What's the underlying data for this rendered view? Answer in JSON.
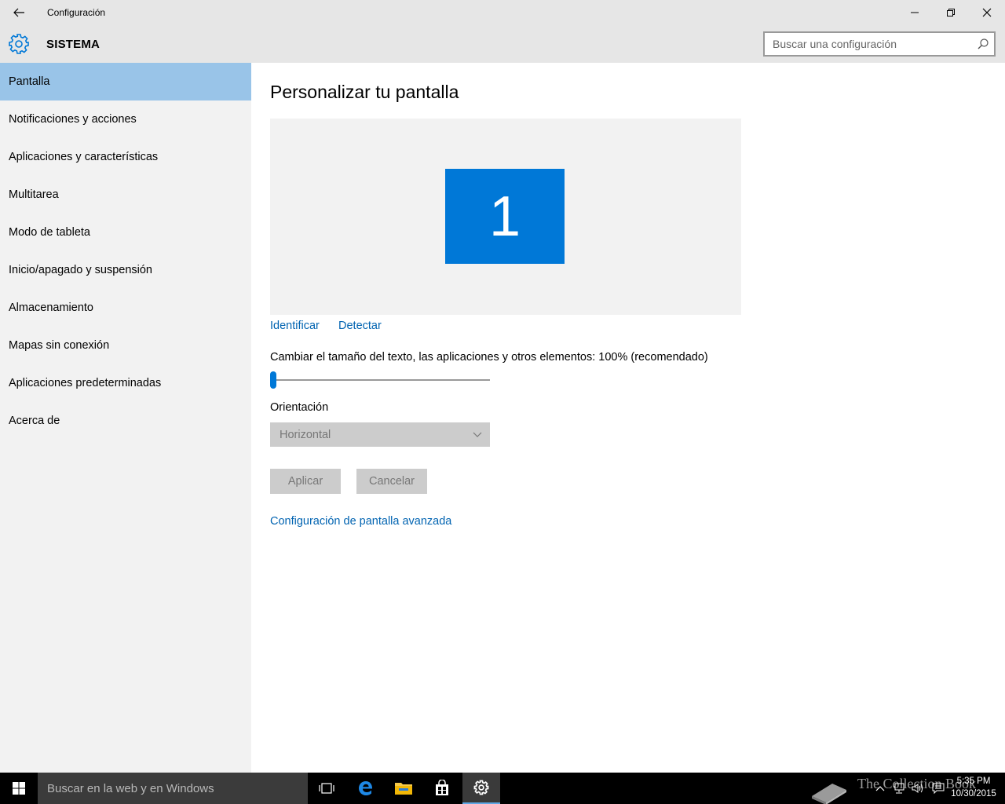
{
  "window": {
    "title": "Configuración",
    "back_icon": "back-arrow-icon",
    "minimize_icon": "minimize-icon",
    "restore_icon": "restore-icon",
    "close_icon": "close-icon"
  },
  "header": {
    "section_icon": "gear-icon",
    "section_title": "SISTEMA",
    "search_placeholder": "Buscar una configuración",
    "search_icon": "search-icon"
  },
  "sidebar": {
    "items": [
      {
        "label": "Pantalla",
        "active": true
      },
      {
        "label": "Notificaciones y acciones"
      },
      {
        "label": "Aplicaciones y características"
      },
      {
        "label": "Multitarea"
      },
      {
        "label": "Modo de tableta"
      },
      {
        "label": "Inicio/apagado y suspensión"
      },
      {
        "label": "Almacenamiento"
      },
      {
        "label": "Mapas sin conexión"
      },
      {
        "label": "Aplicaciones predeterminadas"
      },
      {
        "label": "Acerca de"
      }
    ]
  },
  "main": {
    "title": "Personalizar tu pantalla",
    "monitor_number": "1",
    "identify_link": "Identificar",
    "detect_link": "Detectar",
    "scale_label": "Cambiar el tamaño del texto, las aplicaciones y otros elementos: 100% (recomendado)",
    "scale_slider_value": 0,
    "orientation_label": "Orientación",
    "orientation_value": "Horizontal",
    "apply_button": "Aplicar",
    "cancel_button": "Cancelar",
    "advanced_link": "Configuración de pantalla avanzada"
  },
  "taskbar": {
    "search_text": "Buscar en la web y en Windows",
    "watermark": "The Collection Book",
    "time": "5:35 PM",
    "date": "10/30/2015"
  },
  "colors": {
    "accent": "#0078d7",
    "link": "#0063b1",
    "active_nav": "#99c4e8"
  }
}
